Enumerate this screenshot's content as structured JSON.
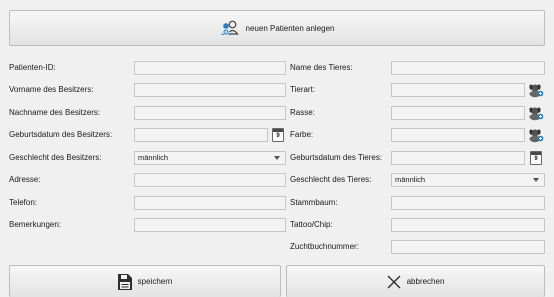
{
  "header": {
    "new_patient_label": "neuen Patienten anlegen"
  },
  "left": {
    "patient_id": {
      "label": "Patienten-ID:",
      "value": ""
    },
    "owner_firstname": {
      "label": "Vorname des Besitzers:",
      "value": ""
    },
    "owner_lastname": {
      "label": "Nachname des Besitzers:",
      "value": ""
    },
    "owner_birthdate": {
      "label": "Geburtsdatum des Besitzers:",
      "value": ""
    },
    "owner_gender": {
      "label": "Geschlecht des Besitzers:",
      "value": "männlich"
    },
    "address": {
      "label": "Adresse:",
      "value": ""
    },
    "phone": {
      "label": "Telefon:",
      "value": ""
    },
    "remarks": {
      "label": "Bemerkungen:",
      "value": ""
    }
  },
  "right": {
    "animal_name": {
      "label": "Name des Tieres:",
      "value": ""
    },
    "animal_type": {
      "label": "Tierart:",
      "value": ""
    },
    "breed": {
      "label": "Rasse:",
      "value": ""
    },
    "color": {
      "label": "Farbe:",
      "value": ""
    },
    "animal_birthdate": {
      "label": "Geburtsdatum des Tieres:",
      "value": ""
    },
    "animal_gender": {
      "label": "Geschlecht des Tieres:",
      "value": "männlich"
    },
    "pedigree": {
      "label": "Stammbaum:",
      "value": ""
    },
    "tattoo_chip": {
      "label": "Tattoo/Chip:",
      "value": ""
    },
    "studbook_number": {
      "label": "Zuchtbuchnummer:",
      "value": ""
    }
  },
  "calendar_glyph": "9",
  "footer": {
    "save_label": "speichern",
    "cancel_label": "abbrechen"
  },
  "icons": [
    "new-patient-icon",
    "calendar-icon",
    "animal-lookup-icon",
    "save-icon",
    "close-icon"
  ]
}
